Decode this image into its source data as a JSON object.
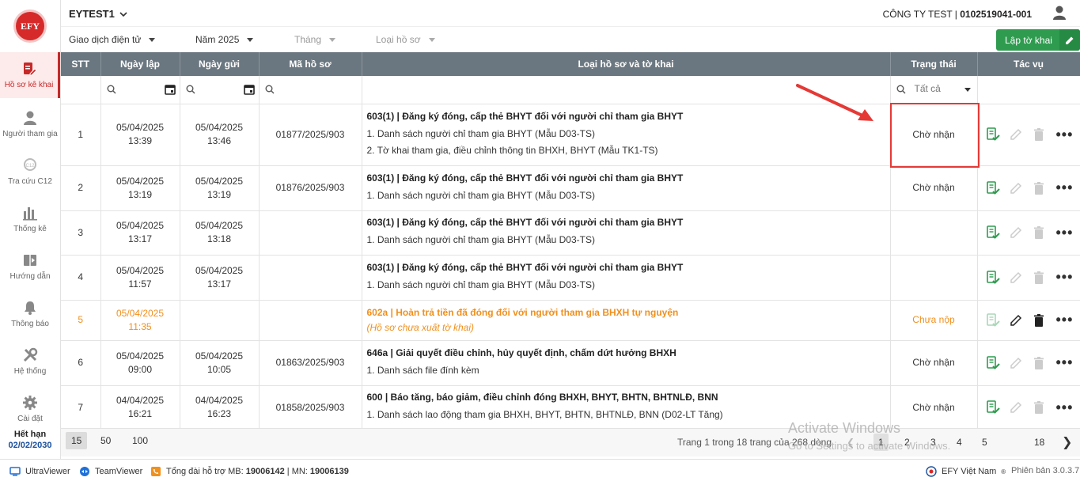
{
  "sidebar": {
    "logo": "EFY",
    "items": [
      {
        "label": "Hồ sơ kê khai",
        "icon": "document-edit-icon"
      },
      {
        "label": "Người tham gia",
        "icon": "person-icon"
      },
      {
        "label": "Tra cứu C12",
        "icon": "search-c12-icon"
      },
      {
        "label": "Thống kê",
        "icon": "bar-chart-icon"
      },
      {
        "label": "Hướng dẫn",
        "icon": "book-icon"
      },
      {
        "label": "Thông báo",
        "icon": "bell-icon"
      },
      {
        "label": "Hệ thống",
        "icon": "tools-icon"
      },
      {
        "label": "Cài đặt",
        "icon": "gear-icon"
      }
    ],
    "expire_label": "Hết hạn",
    "expire_date": "02/02/2030"
  },
  "topbar": {
    "org": "EYTEST1",
    "company_name": "CÔNG TY TEST | ",
    "company_code": "0102519041-001"
  },
  "filters": {
    "transaction": "Giao dịch điện tử",
    "year": "Năm 2025",
    "month": "Tháng",
    "type": "Loại hồ sơ",
    "create_label": "Lập tờ khai"
  },
  "table": {
    "headers": {
      "stt": "STT",
      "created": "Ngày lập",
      "sent": "Ngày gửi",
      "code": "Mã hồ sơ",
      "type": "Loại hồ sơ và tờ khai",
      "status": "Trạng thái",
      "actions": "Tác vụ"
    },
    "status_filter": "Tất cả",
    "rows": [
      {
        "stt": "1",
        "created_date": "05/04/2025",
        "created_time": "13:39",
        "sent_date": "05/04/2025",
        "sent_time": "13:46",
        "code": "01877/2025/903",
        "title": "603(1) | Đăng ký đóng, cấp thẻ BHYT đối với người chỉ tham gia BHYT",
        "subs": [
          "1. Danh sách người chỉ tham gia BHYT (Mẫu D03-TS)",
          "2. Tờ khai tham gia, điều chỉnh thông tin BHXH, BHYT (Mẫu TK1-TS)"
        ],
        "status": "Chờ nhận"
      },
      {
        "stt": "2",
        "created_date": "05/04/2025",
        "created_time": "13:19",
        "sent_date": "05/04/2025",
        "sent_time": "13:19",
        "code": "01876/2025/903",
        "title": "603(1) | Đăng ký đóng, cấp thẻ BHYT đối với người chỉ tham gia BHYT",
        "subs": [
          "1. Danh sách người chỉ tham gia BHYT (Mẫu D03-TS)"
        ],
        "status": "Chờ nhận"
      },
      {
        "stt": "3",
        "created_date": "05/04/2025",
        "created_time": "13:17",
        "sent_date": "05/04/2025",
        "sent_time": "13:18",
        "code": "",
        "title": "603(1) | Đăng ký đóng, cấp thẻ BHYT đối với người chỉ tham gia BHYT",
        "subs": [
          "1. Danh sách người chỉ tham gia BHYT (Mẫu D03-TS)"
        ],
        "status": ""
      },
      {
        "stt": "4",
        "created_date": "05/04/2025",
        "created_time": "11:57",
        "sent_date": "05/04/2025",
        "sent_time": "13:17",
        "code": "",
        "title": "603(1) | Đăng ký đóng, cấp thẻ BHYT đối với người chỉ tham gia BHYT",
        "subs": [
          "1. Danh sách người chỉ tham gia BHYT (Mẫu D03-TS)"
        ],
        "status": ""
      },
      {
        "stt": "5",
        "created_date": "05/04/2025",
        "created_time": "11:35",
        "sent_date": "",
        "sent_time": "",
        "code": "",
        "title": "602a | Hoàn trả tiền đã đóng đối với người tham gia BHXH tự nguyện",
        "note": "(Hồ sơ chưa xuất tờ khai)",
        "subs": [],
        "status": "Chưa nộp"
      },
      {
        "stt": "6",
        "created_date": "05/04/2025",
        "created_time": "09:00",
        "sent_date": "05/04/2025",
        "sent_time": "10:05",
        "code": "01863/2025/903",
        "title": "646a | Giải quyết điều chỉnh, hủy quyết định, chấm dứt hưởng BHXH",
        "subs": [
          "1. Danh sách file đính kèm"
        ],
        "status": "Chờ nhận"
      },
      {
        "stt": "7",
        "created_date": "04/04/2025",
        "created_time": "16:21",
        "sent_date": "04/04/2025",
        "sent_time": "16:23",
        "code": "01858/2025/903",
        "title": "600 | Báo tăng, báo giảm, điều chỉnh đóng BHXH, BHYT, BHTN, BHTNLĐ, BNN",
        "subs": [
          "1. Danh sách lao động tham gia BHXH, BHYT, BHTN, BHTNLĐ, BNN (D02-LT Tăng)"
        ],
        "status": "Chờ nhận"
      }
    ]
  },
  "pager": {
    "sizes": [
      "15",
      "50",
      "100"
    ],
    "info": "Trang 1 trong 18 trang của 268 dòng",
    "pages": [
      "1",
      "2",
      "3",
      "4",
      "5",
      "18"
    ],
    "watermark_title": "Activate Windows",
    "watermark_sub": "Go to Settings to activate Windows."
  },
  "bottom": {
    "ultraviewer": "UltraViewer",
    "teamviewer": "TeamViewer",
    "hotline_label": "Tổng đài hỗ trợ MB: ",
    "hotline_mb": "19006142",
    "hotline_sep": " | MN: ",
    "hotline_mn": "19006139",
    "brand": "EFY Việt Nam",
    "version": "Phiên bản 3.0.3.7"
  },
  "colors": {
    "accent": "#c62828",
    "header": "#6b7780",
    "green": "#2e9b4f",
    "orange": "#f0901e"
  }
}
